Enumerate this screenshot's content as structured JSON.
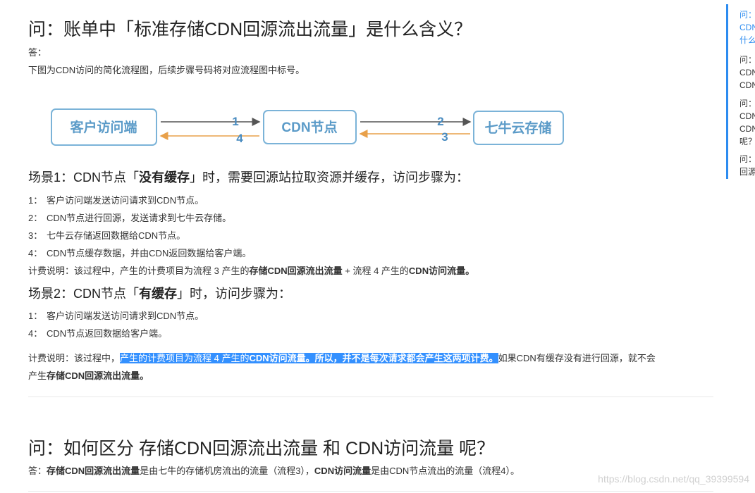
{
  "q1": {
    "title": "问：账单中「标准存储CDN回源流出流量」是什么含义？",
    "answer_label": "答：",
    "intro": "下图为CDN访问的简化流程图，后续步骤号码将对应流程图中标号。"
  },
  "diagram": {
    "client": "客户访问端",
    "cdn": "CDN节点",
    "storage": "七牛云存储",
    "arrow1": "1",
    "arrow2": "2",
    "arrow3": "3",
    "arrow4": "4",
    "colors": {
      "box_border": "#7bb3d8",
      "box_text": "#5b9bc8",
      "arrow_dark": "#555555",
      "arrow_orange": "#e8a04a"
    }
  },
  "scene1": {
    "prefix": "场景1：CDN节点「",
    "bold": "没有缓存",
    "suffix": "」时，需要回源站拉取资源并缓存，访问步骤为：",
    "steps": [
      {
        "num": "1：",
        "text": "客户访问端发送访问请求到CDN节点。"
      },
      {
        "num": "2：",
        "text": "CDN节点进行回源，发送请求到七牛云存储。"
      },
      {
        "num": "3：",
        "text": "七牛云存储返回数据给CDN节点。"
      },
      {
        "num": "4：",
        "text": "CDN节点缓存数据，并由CDN返回数据给客户端。"
      }
    ],
    "billing_a": "计费说明：该过程中，产生的计费项目为流程 3 产生的",
    "billing_b": "存储CDN回源流出流量",
    "billing_c": " + 流程 4 产生的",
    "billing_d": "CDN访问流量。"
  },
  "scene2": {
    "prefix": "场景2：CDN节点「",
    "bold": "有缓存",
    "suffix": "」时，访问步骤为：",
    "steps": [
      {
        "num": "1：",
        "text": "客户访问端发送访问请求到CDN节点。"
      },
      {
        "num": "4：",
        "text": "CDN节点返回数据给客户端。"
      }
    ],
    "billing_a": "计费说明：该过程中，",
    "billing_hl_a": "产生的计费项目为流程 4 产生的",
    "billing_hl_b": "CDN访问流量。所以，并不是每次请求都会产生这两项计费。",
    "billing_c": "如果CDN有缓存没有进行回源，就不会",
    "billing_line2_a": "产生",
    "billing_line2_b": "存储CDN回源流出流量。"
  },
  "q2": {
    "title": "问：如何区分 存储CDN回源流出流量 和 CDN访问流量 呢？",
    "answer_label": "答：",
    "bold1": "存储CDN回源流出流量",
    "text1": "是由七牛的存储机房流出的流量（流程3），",
    "bold2": "CDN访问流量",
    "text2": "是由CDN节点流出的流量（流程4）。"
  },
  "watermark": "https://blog.csdn.net/qq_39399594",
  "toc": {
    "items": [
      {
        "lines": [
          "问：",
          "CDN",
          "什么"
        ],
        "active": true
      },
      {
        "lines": [
          "问：",
          "CDN",
          "CDN"
        ],
        "active": false
      },
      {
        "lines": [
          "问：",
          "CDN",
          "CDN",
          "呢？"
        ],
        "active": false
      },
      {
        "lines": [
          "问：",
          "回源"
        ],
        "active": false
      }
    ]
  }
}
